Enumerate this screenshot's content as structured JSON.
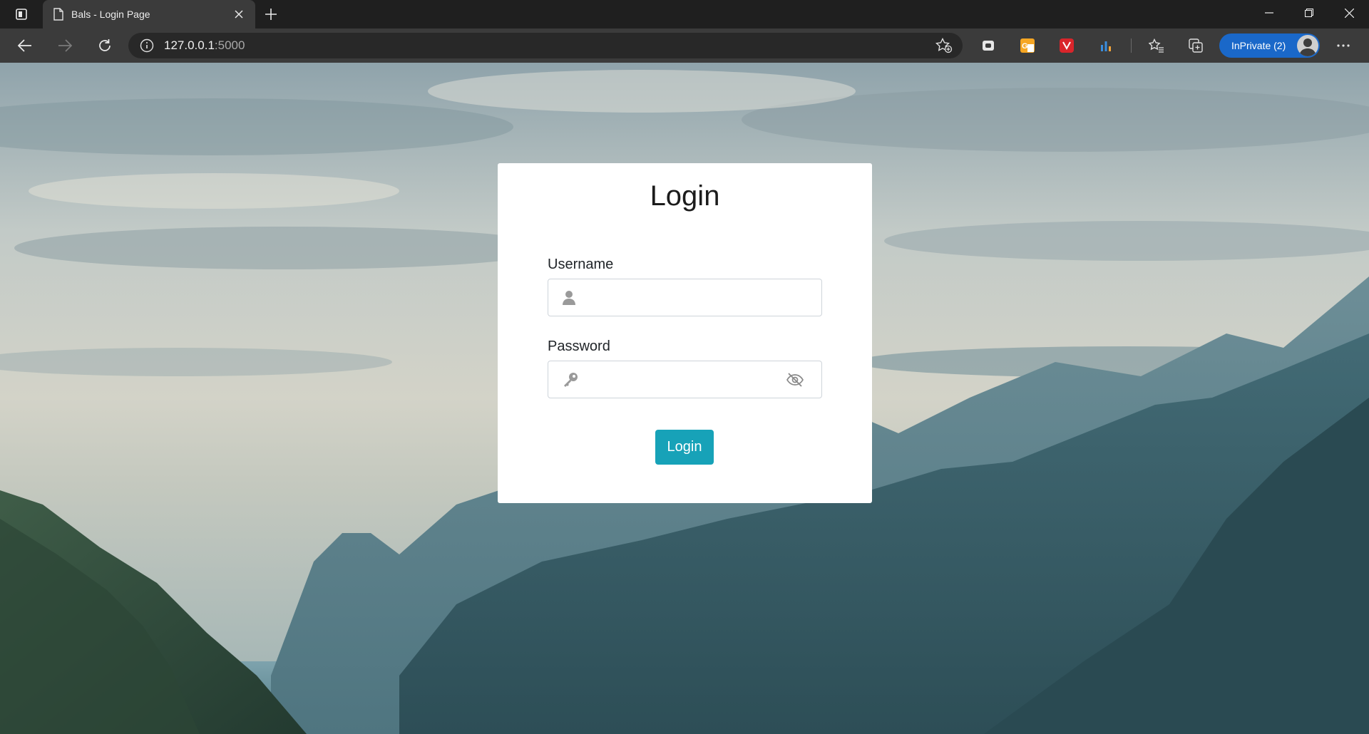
{
  "browser": {
    "tab_title": "Bals - Login Page",
    "url_host": "127.0.0.1",
    "url_port": ":5000",
    "inprivate_label": "InPrivate (2)"
  },
  "login": {
    "title": "Login",
    "username_label": "Username",
    "username_value": "",
    "password_label": "Password",
    "password_value": "",
    "submit_label": "Login"
  },
  "colors": {
    "accent": "#17a2b8",
    "inprivate": "#1a68c9"
  }
}
